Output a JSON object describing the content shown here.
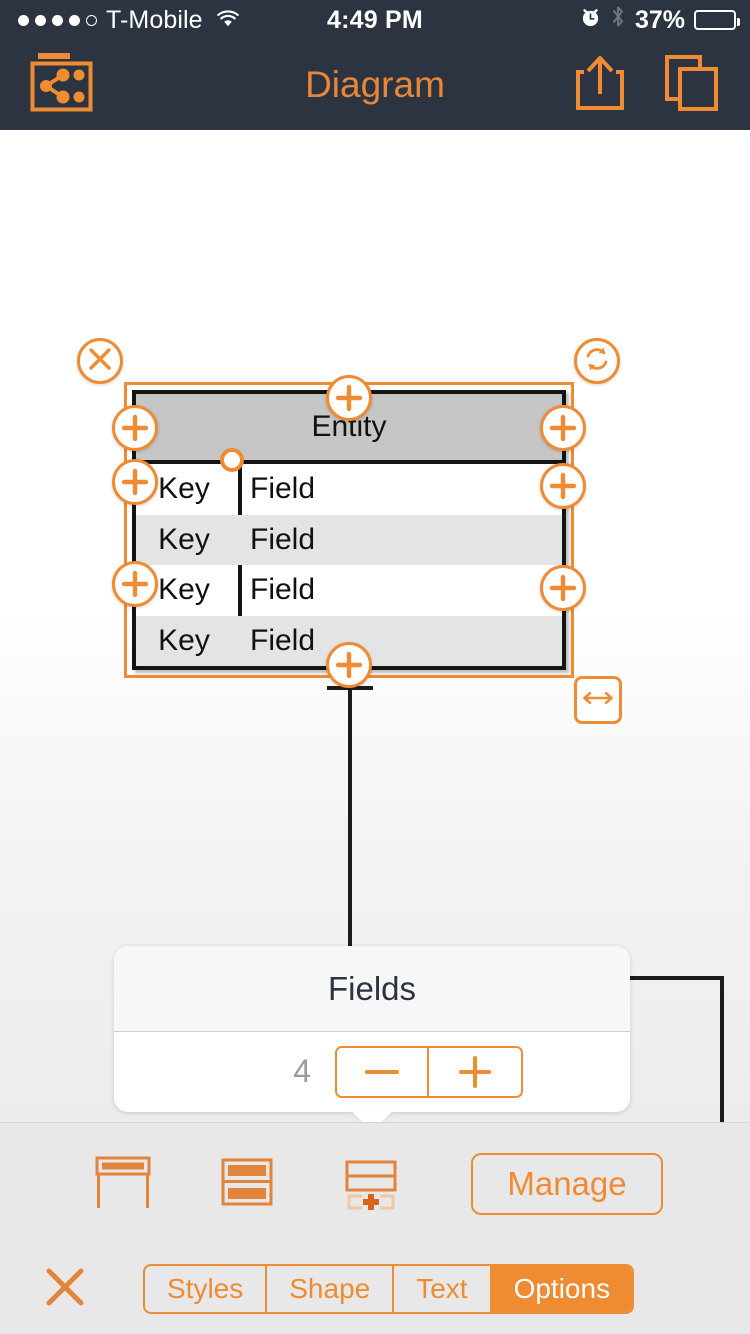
{
  "status_bar": {
    "signal_dots": 5,
    "signal_filled": 4,
    "carrier": "T-Mobile",
    "wifi_icon": "wifi-icon",
    "time": "4:49 PM",
    "alarm_icon": "alarm-icon",
    "bluetooth_icon": "bluetooth-icon",
    "battery_percent": "37%",
    "battery_level": 37
  },
  "nav_bar": {
    "title": "Diagram",
    "left_icon": "diagram-browser-icon",
    "share_icon": "share-icon",
    "copy_icon": "documents-icon",
    "bg_color": "#2b3440",
    "accent_color": "#e8873a"
  },
  "canvas": {
    "entity": {
      "title": "Entity",
      "rows": [
        {
          "key": "Key",
          "field": "Field"
        },
        {
          "key": "Key",
          "field": "Field"
        },
        {
          "key": "Key",
          "field": "Field"
        },
        {
          "key": "Key",
          "field": "Field"
        }
      ]
    },
    "handles": {
      "delete_icon": "close-circle-icon",
      "rotate_icon": "rotate-refresh-icon",
      "add_icon": "plus-icon",
      "resize_icon": "horizontal-resize-icon",
      "column_divider_icon": "column-divider-handle"
    },
    "selection_color": "#ef8b33"
  },
  "popover": {
    "title": "Fields",
    "count": "4",
    "minus_label": "—",
    "plus_label": "+"
  },
  "bottom_panel": {
    "tools": [
      {
        "name": "header-only-icon",
        "label": "Header Only"
      },
      {
        "name": "striped-rows-icon",
        "label": "Striped Rows"
      },
      {
        "name": "add-row-icon",
        "label": "Add Row"
      }
    ],
    "manage_label": "Manage",
    "close_icon": "close-icon",
    "tabs": [
      {
        "label": "Styles",
        "active": false
      },
      {
        "label": "Shape",
        "active": false
      },
      {
        "label": "Text",
        "active": false
      },
      {
        "label": "Options",
        "active": true
      }
    ],
    "accent_color": "#ef8b33",
    "bg_color": "#e8e8e8"
  }
}
